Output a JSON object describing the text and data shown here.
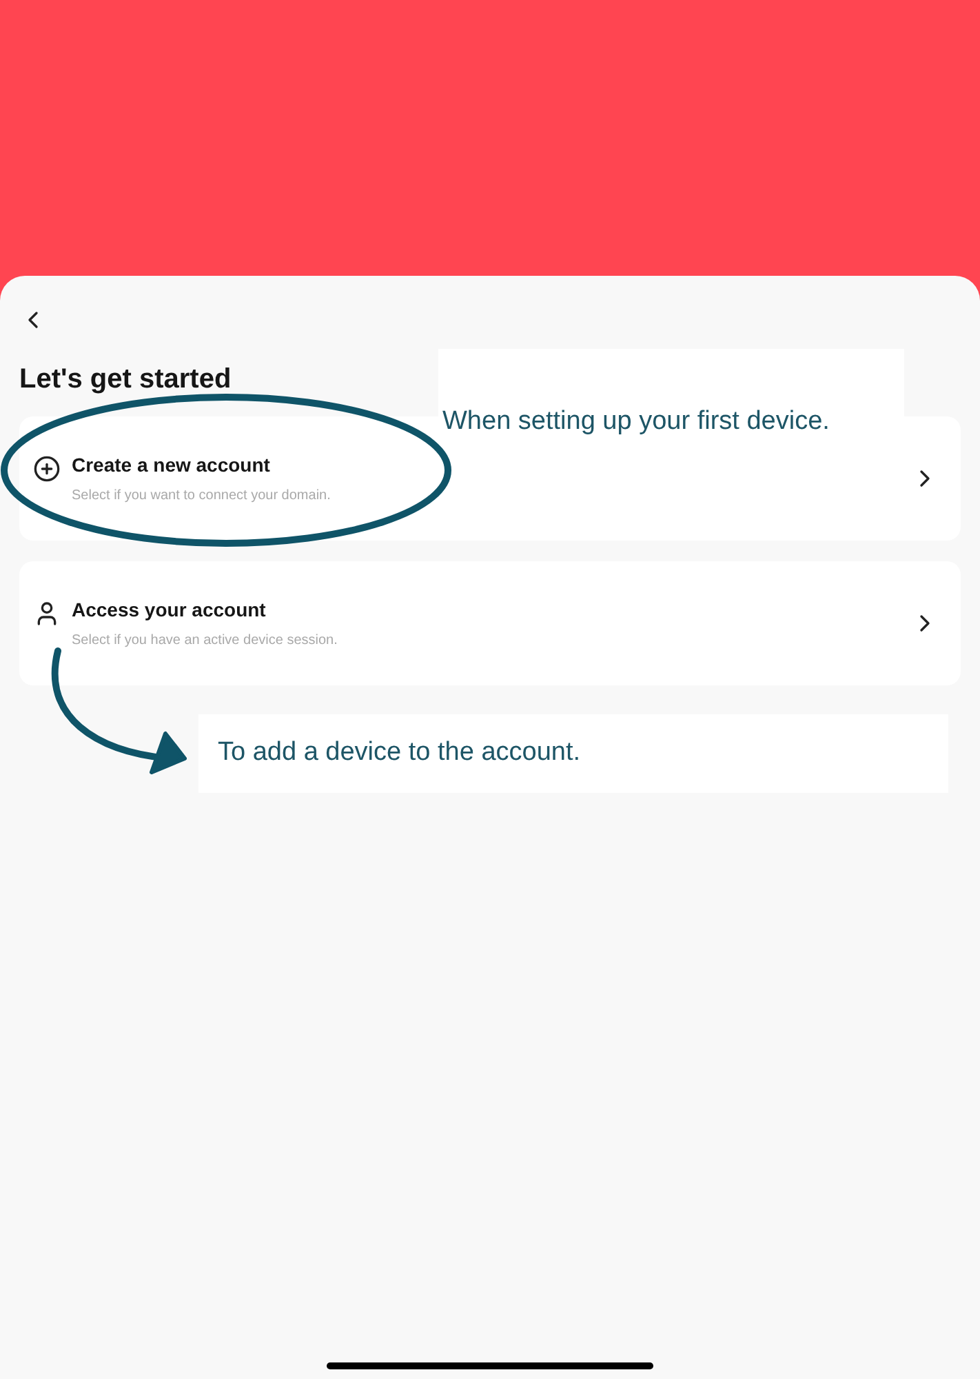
{
  "title": "Let's get started",
  "options": [
    {
      "kind": "create",
      "title": "Create a new account",
      "subtitle": "Select if you want to connect your domain."
    },
    {
      "kind": "access",
      "title": "Access your account",
      "subtitle": "Select if you have an active device session."
    }
  ],
  "annotations": [
    "When setting up your first device.",
    "To add a device to the account."
  ]
}
